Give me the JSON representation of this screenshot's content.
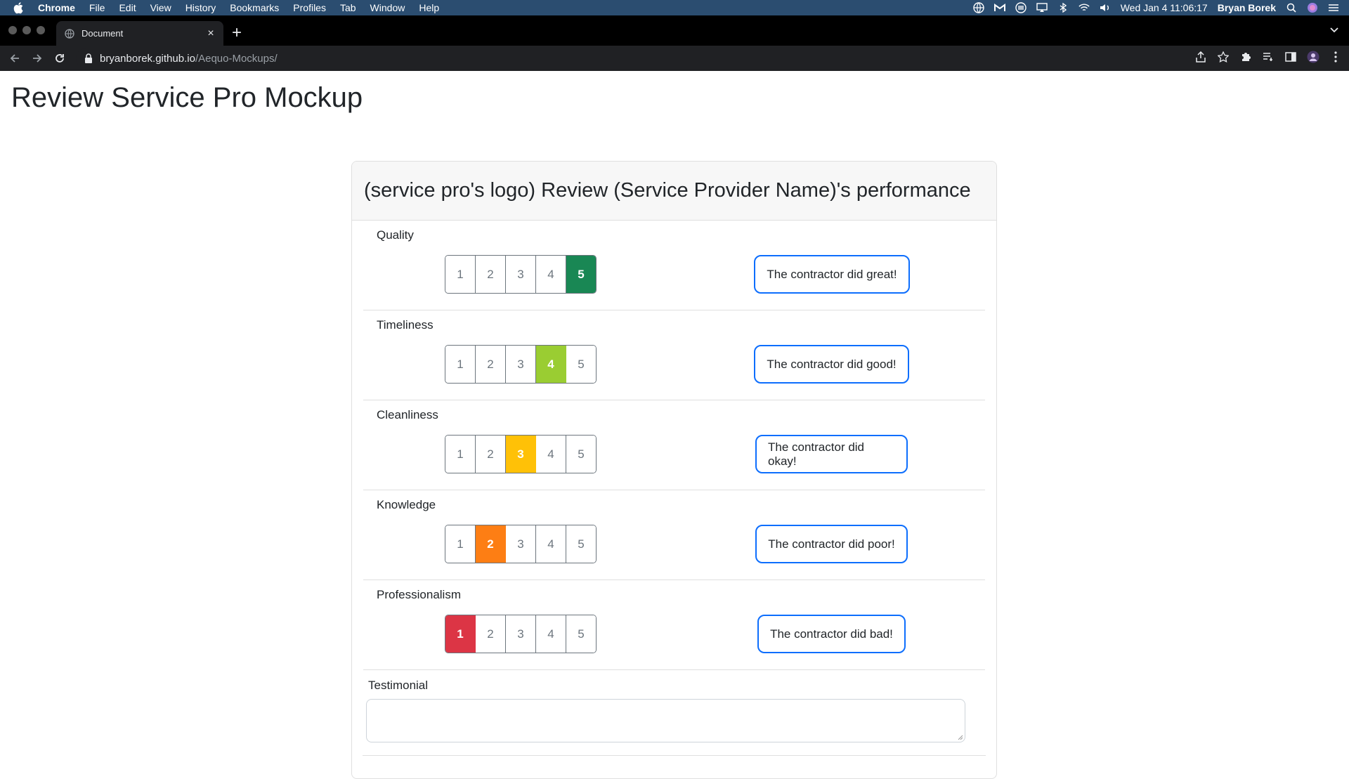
{
  "menubar": {
    "app": "Chrome",
    "items": [
      "File",
      "Edit",
      "View",
      "History",
      "Bookmarks",
      "Profiles",
      "Tab",
      "Window",
      "Help"
    ],
    "clock": "Wed Jan 4  11:06:17",
    "user": "Bryan Borek"
  },
  "browser": {
    "tab_title": "Document",
    "url_host": "bryanborek.github.io",
    "url_path": "/Aequo-Mockups/"
  },
  "page": {
    "title": "Review Service Pro Mockup",
    "card_header": "(service pro's logo) Review (Service Provider Name)'s performance",
    "categories": [
      {
        "label": "Quality",
        "options": [
          "1",
          "2",
          "3",
          "4",
          "5"
        ],
        "selected": 5,
        "selected_color": "#198754",
        "comment": "The contractor did great!"
      },
      {
        "label": "Timeliness",
        "options": [
          "1",
          "2",
          "3",
          "4",
          "5"
        ],
        "selected": 4,
        "selected_color": "#9acd32",
        "comment": "The contractor did good!"
      },
      {
        "label": "Cleanliness",
        "options": [
          "1",
          "2",
          "3",
          "4",
          "5"
        ],
        "selected": 3,
        "selected_color": "#ffc107",
        "comment": "The contractor did okay!"
      },
      {
        "label": "Knowledge",
        "options": [
          "1",
          "2",
          "3",
          "4",
          "5"
        ],
        "selected": 2,
        "selected_color": "#fd7e14",
        "comment": "The contractor did poor!"
      },
      {
        "label": "Professionalism",
        "options": [
          "1",
          "2",
          "3",
          "4",
          "5"
        ],
        "selected": 1,
        "selected_color": "#dc3545",
        "comment": "The contractor did bad!"
      }
    ],
    "testimonial_label": "Testimonial",
    "testimonial_value": ""
  }
}
